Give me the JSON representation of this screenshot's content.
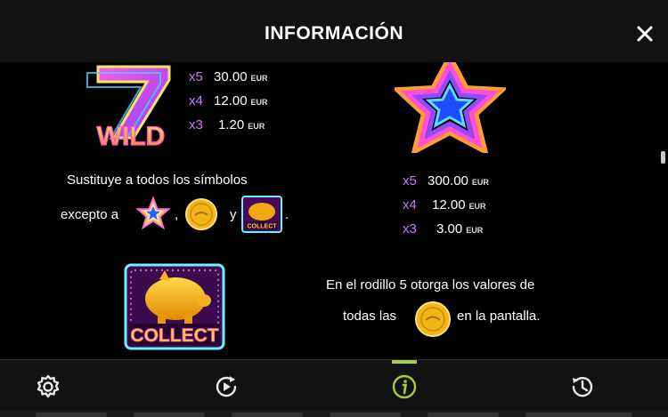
{
  "header": {
    "title": "INFORMACIÓN",
    "close_icon": "close-icon"
  },
  "wild": {
    "symbol_label": "WILD",
    "payouts": [
      {
        "mult": "x5",
        "value": "30.00",
        "currency": "EUR"
      },
      {
        "mult": "x4",
        "value": "12.00",
        "currency": "EUR"
      },
      {
        "mult": "x3",
        "value": "1.20",
        "currency": "EUR"
      }
    ],
    "description_line1": "Sustituye a todos los símbolos",
    "description_prefix": "excepto a",
    "description_sep1": ",",
    "description_and": "y",
    "description_end": "."
  },
  "star": {
    "payouts": [
      {
        "mult": "x5",
        "value": "300.00",
        "currency": "EUR"
      },
      {
        "mult": "x4",
        "value": "12.00",
        "currency": "EUR"
      },
      {
        "mult": "x3",
        "value": "3.00",
        "currency": "EUR"
      }
    ]
  },
  "collect": {
    "symbol_label": "COLLECT",
    "description_line1": "En el rodillo 5 otorga los valores de",
    "description_line2_prefix": "todas las",
    "description_line2_suffix": "en la pantalla."
  },
  "bottom_nav": [
    {
      "icon": "gear-icon",
      "active": false
    },
    {
      "icon": "autoplay-icon",
      "active": false
    },
    {
      "icon": "info-icon",
      "active": true
    },
    {
      "icon": "history-icon",
      "active": false
    }
  ],
  "colors": {
    "accent": "#a7cf3c",
    "multiplier": "#c77bf0",
    "topbar": "#121212"
  }
}
